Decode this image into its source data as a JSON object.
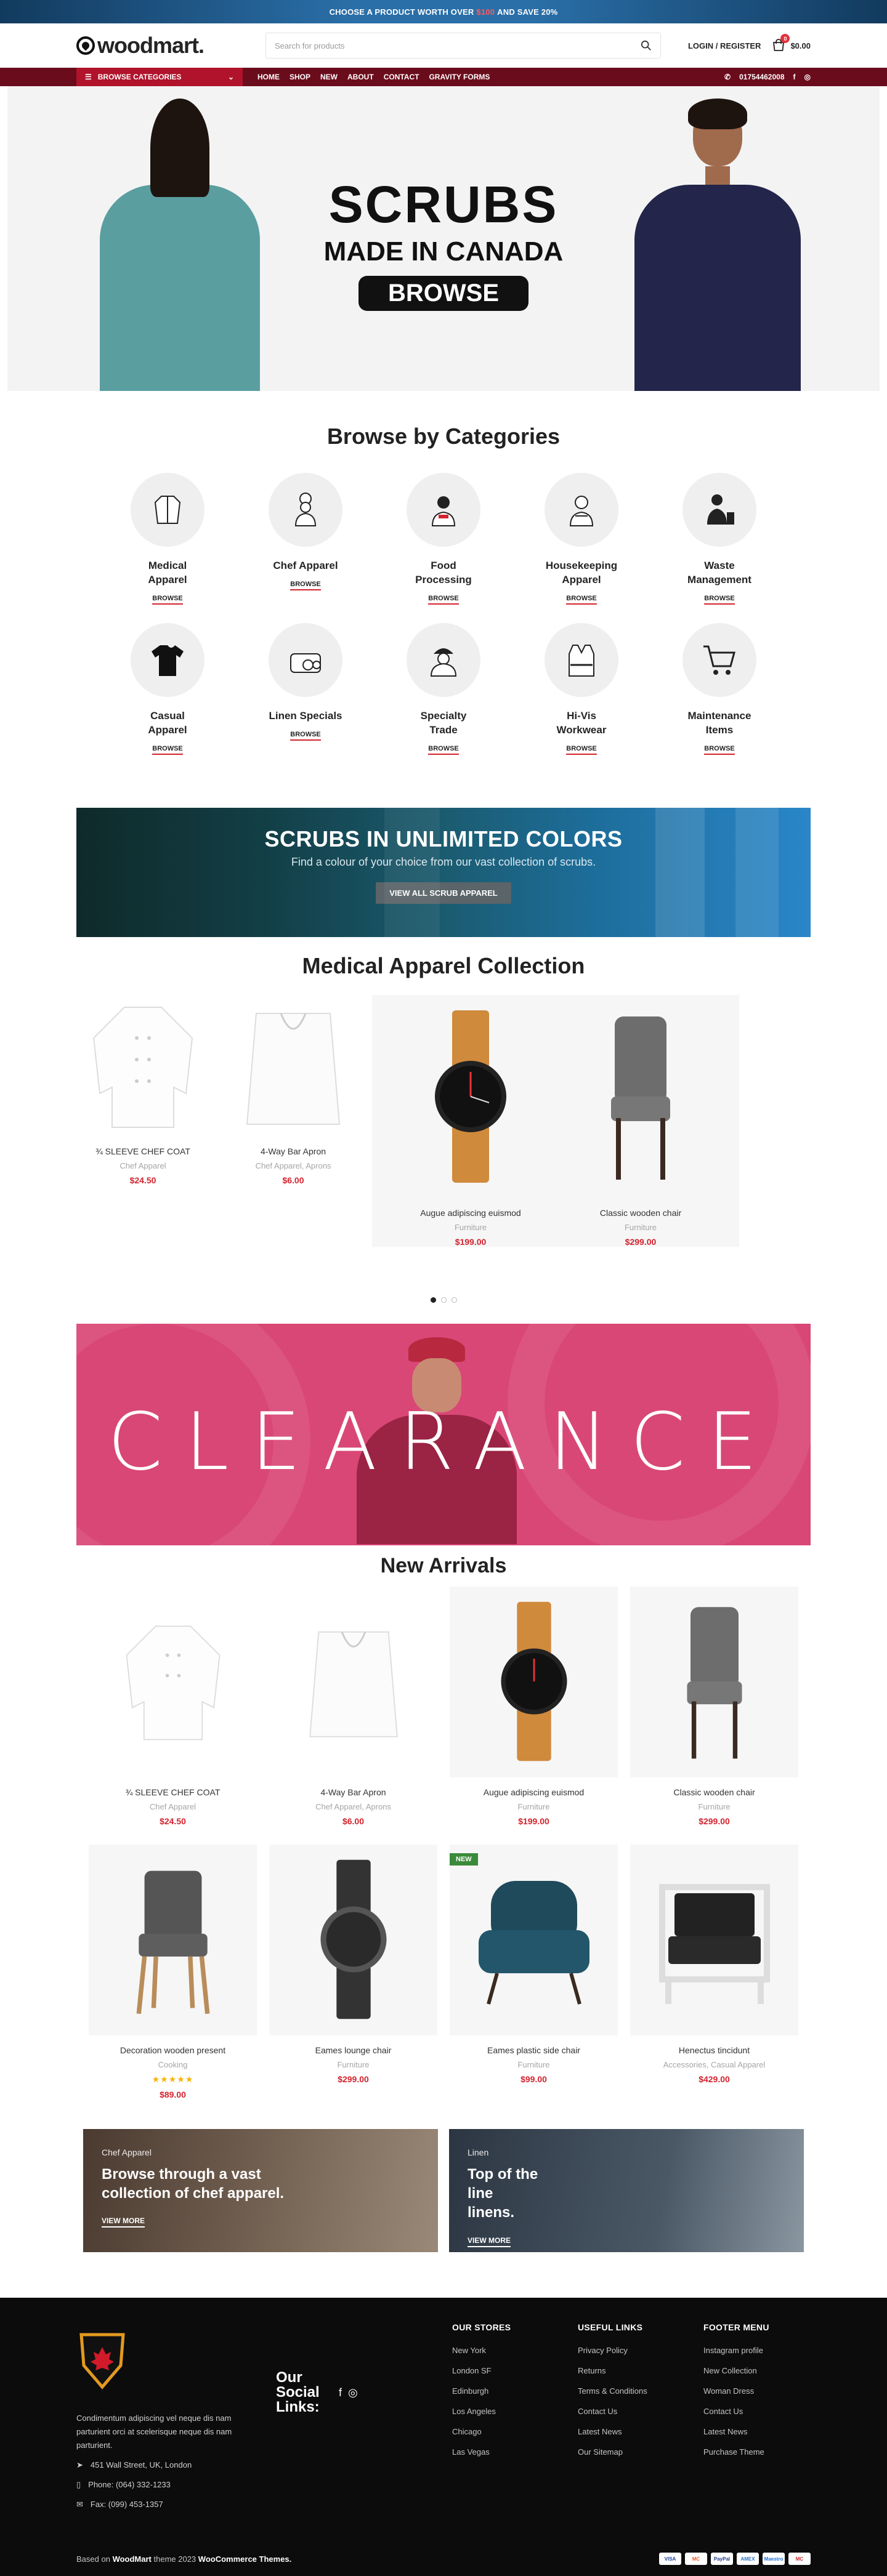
{
  "topbar": {
    "pre": "CHOOSE A PRODUCT WORTH OVER",
    "amount": "$100",
    "post": "AND SAVE 20%"
  },
  "header": {
    "logo": "woodmart.",
    "search_placeholder": "Search for products",
    "login": "LOGIN / REGISTER",
    "cart_count": "0",
    "cart_total": "$0.00"
  },
  "nav": {
    "browse": "BROWSE CATEGORIES",
    "menu": [
      "HOME",
      "SHOP",
      "NEW",
      "ABOUT",
      "CONTACT",
      "GRAVITY FORMS"
    ],
    "phone": "01754462008"
  },
  "hero": {
    "title": "SCRUBS",
    "subtitle": "MADE IN CANADA",
    "button": "BROWSE"
  },
  "categories": {
    "title": "Browse by Categories",
    "browse_label": "BROWSE",
    "items": [
      {
        "name": "Medical Apparel",
        "icon": "coat-icon"
      },
      {
        "name": "Chef Apparel",
        "icon": "chef-icon"
      },
      {
        "name": "Food Processing",
        "icon": "food-worker-icon"
      },
      {
        "name": "Housekeeping Apparel",
        "icon": "housekeeper-icon"
      },
      {
        "name": "Waste Management",
        "icon": "waste-icon"
      },
      {
        "name": "Casual Apparel",
        "icon": "tshirt-icon"
      },
      {
        "name": "Linen Specials",
        "icon": "linen-icon"
      },
      {
        "name": "Specialty Trade",
        "icon": "worker-helmet-icon"
      },
      {
        "name": "Hi-Vis Workwear",
        "icon": "vest-icon"
      },
      {
        "name": "Maintenance Items",
        "icon": "cart-icon"
      }
    ]
  },
  "scrub_banner": {
    "title": "SCRUBS IN UNLIMITED COLORS",
    "text": "Find a colour of your choice from our vast collection of scrubs.",
    "button": "VIEW ALL SCRUB APPAREL"
  },
  "medical": {
    "title": "Medical Apparel Collection",
    "products": [
      {
        "name": "¾ SLEEVE CHEF COAT",
        "cat": "Chef Apparel",
        "price": "$24.50",
        "img": "chef-coat"
      },
      {
        "name": "4-Way Bar Apron",
        "cat": "Chef Apparel, Aprons",
        "price": "$6.00",
        "img": "apron"
      },
      {
        "name": "Augue adipiscing euismod",
        "cat": "Furniture",
        "price": "$199.00",
        "img": "watch"
      },
      {
        "name": "Classic wooden chair",
        "cat": "Furniture",
        "price": "$299.00",
        "img": "chair-gray"
      }
    ]
  },
  "clearance": {
    "word": "CLEARANCE"
  },
  "arrivals": {
    "title": "New Arrivals",
    "new_badge": "NEW",
    "row1": [
      {
        "name": "¾ SLEEVE CHEF COAT",
        "cat": "Chef Apparel",
        "price": "$24.50",
        "img": "chef-coat"
      },
      {
        "name": "4-Way Bar Apron",
        "cat": "Chef Apparel, Aprons",
        "price": "$6.00",
        "img": "apron"
      },
      {
        "name": "Augue adipiscing euismod",
        "cat": "Furniture",
        "price": "$199.00",
        "img": "watch"
      },
      {
        "name": "Classic wooden chair",
        "cat": "Furniture",
        "price": "$299.00",
        "img": "chair-gray"
      }
    ],
    "row2": [
      {
        "name": "Decoration wooden present",
        "cat": "Cooking",
        "price": "$89.00",
        "img": "chair-wood",
        "rating": "5 of 5 stars"
      },
      {
        "name": "Eames lounge chair",
        "cat": "Furniture",
        "price": "$299.00",
        "img": "watch-black"
      },
      {
        "name": "Eames plastic side chair",
        "cat": "Furniture",
        "price": "$99.00",
        "img": "armchair-blue"
      },
      {
        "name": "Henectus tincidunt",
        "cat": "Accessories, Casual Apparel",
        "price": "$429.00",
        "img": "armchair-black"
      }
    ]
  },
  "promos": [
    {
      "cap": "Chef Apparel",
      "title": "Browse through a vast collection of chef apparel.",
      "link": "VIEW MORE",
      "color": "#5a4636"
    },
    {
      "cap": "Linen",
      "title": "Top of the line linens.",
      "link": "VIEW MORE",
      "color": "#3d4a57"
    }
  ],
  "footer": {
    "about": "Condimentum adipiscing vel neque dis nam parturient orci at scelerisque neque dis nam parturient.",
    "address": "451 Wall Street, UK, London",
    "phone": "Phone: (064) 332-1233",
    "fax": "Fax: (099) 453-1357",
    "social_label": "Our Social Links:",
    "cols": [
      {
        "title": "OUR STORES",
        "links": [
          "New York",
          "London SF",
          "Edinburgh",
          "Los Angeles",
          "Chicago",
          "Las Vegas"
        ]
      },
      {
        "title": "USEFUL LINKS",
        "links": [
          "Privacy Policy",
          "Returns",
          "Terms & Conditions",
          "Contact Us",
          "Latest News",
          "Our Sitemap"
        ]
      },
      {
        "title": "FOOTER MENU",
        "links": [
          "Instagram profile",
          "New Collection",
          "Woman Dress",
          "Contact Us",
          "Latest News",
          "Purchase Theme"
        ]
      }
    ],
    "copy_pre": "Based on",
    "copy_brand": "WoodMart",
    "copy_mid": "theme 2023",
    "copy_brand2": "WooCommerce Themes.",
    "cards": [
      "VISA",
      "MC",
      "PayPal",
      "AMEX",
      "Maestro",
      "MC"
    ]
  }
}
